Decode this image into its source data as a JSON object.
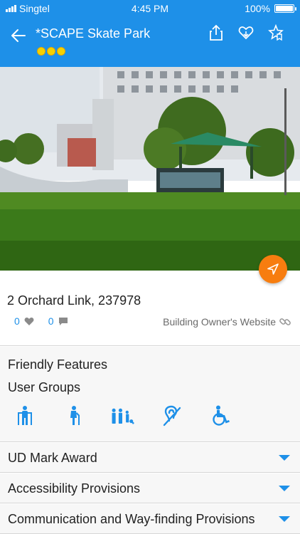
{
  "status_bar": {
    "carrier": "Singtel",
    "time": "4:45 PM",
    "battery": "100%",
    "battery_level": 1.0
  },
  "nav": {
    "title": "*SCAPE Skate Park",
    "rating_dots": 3,
    "icons": [
      "back-arrow-icon",
      "share-icon",
      "favorite-add-icon",
      "bookmark-star-icon"
    ]
  },
  "colors": {
    "header_blue": "#1e90e8",
    "fab_orange": "#f77d0f",
    "rating_yellow": "#f5d200"
  },
  "place": {
    "address": "2 Orchard Link, 237978",
    "likes": "0",
    "comments": "0",
    "website_label": "Building Owner's Website"
  },
  "features": {
    "friendly_features_label": "Friendly Features",
    "user_groups_label": "User Groups",
    "user_group_icons": [
      "elderly-icon",
      "walking-cane-icon",
      "family-icon",
      "hearing-impaired-icon",
      "wheelchair-icon"
    ]
  },
  "accordion": [
    {
      "label": "UD Mark Award"
    },
    {
      "label": "Accessibility Provisions"
    },
    {
      "label": "Communication and Way-finding Provisions"
    }
  ]
}
